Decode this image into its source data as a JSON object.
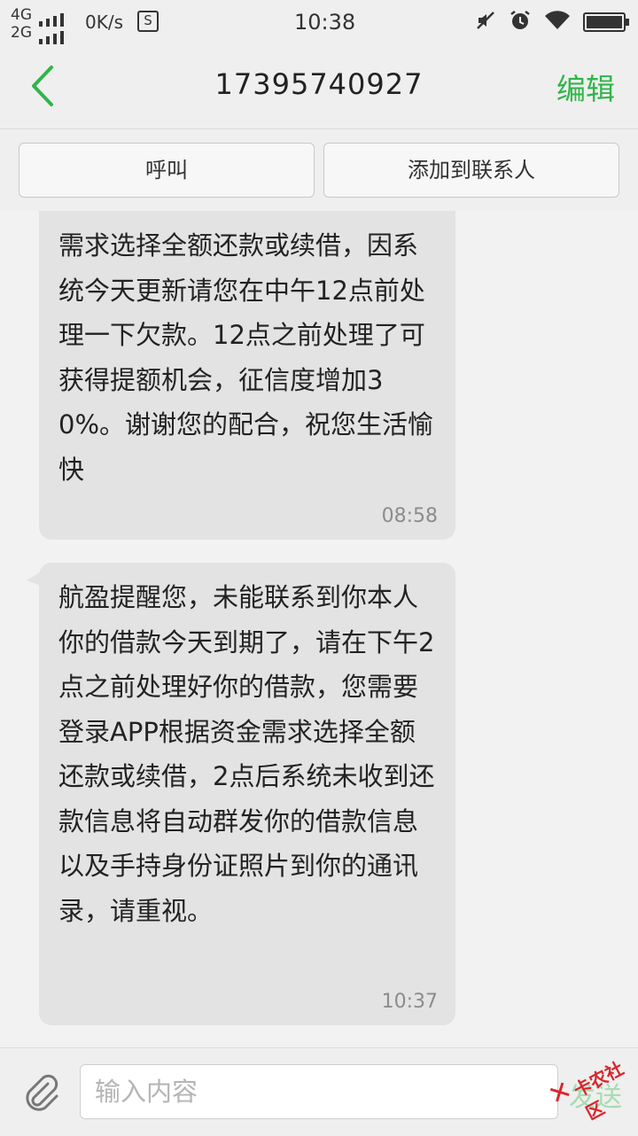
{
  "status_bar": {
    "net_top": "4G",
    "net_bottom": "2G",
    "speed": "0K/s",
    "data_icon_glyph": "S",
    "time": "10:38",
    "icons": [
      "mute-icon",
      "alarm-icon",
      "wifi-icon",
      "battery-icon"
    ]
  },
  "header": {
    "back_icon": "chevron-left-icon",
    "title": "17395740927",
    "edit_label": "编辑",
    "accent_color": "#2fb54a"
  },
  "actions": {
    "call_label": "呼叫",
    "add_contact_label": "添加到联系人"
  },
  "messages": [
    {
      "text": "需求选择全额还款或续借，因系统今天更新请您在中午12点前处理一下欠款。12点之前处理了可获得提额机会，征信度增加30%。谢谢您的配合，祝您生活愉快",
      "time": "08:58"
    },
    {
      "text": " 航盈提醒您，未能联系到你本人你的借款今天到期了，请在下午2点之前处理好你的借款，您需要登录APP根据资金需求选择全额还款或续借，2点后系统未收到还款信息将自动群发你的借款信息以及手持身份证照片到你的通讯录，请重视。",
      "time": "10:37"
    }
  ],
  "composer": {
    "attach_icon": "paperclip-icon",
    "placeholder": "输入内容",
    "send_label": "发送"
  },
  "watermark": {
    "text": "卡农社区"
  }
}
